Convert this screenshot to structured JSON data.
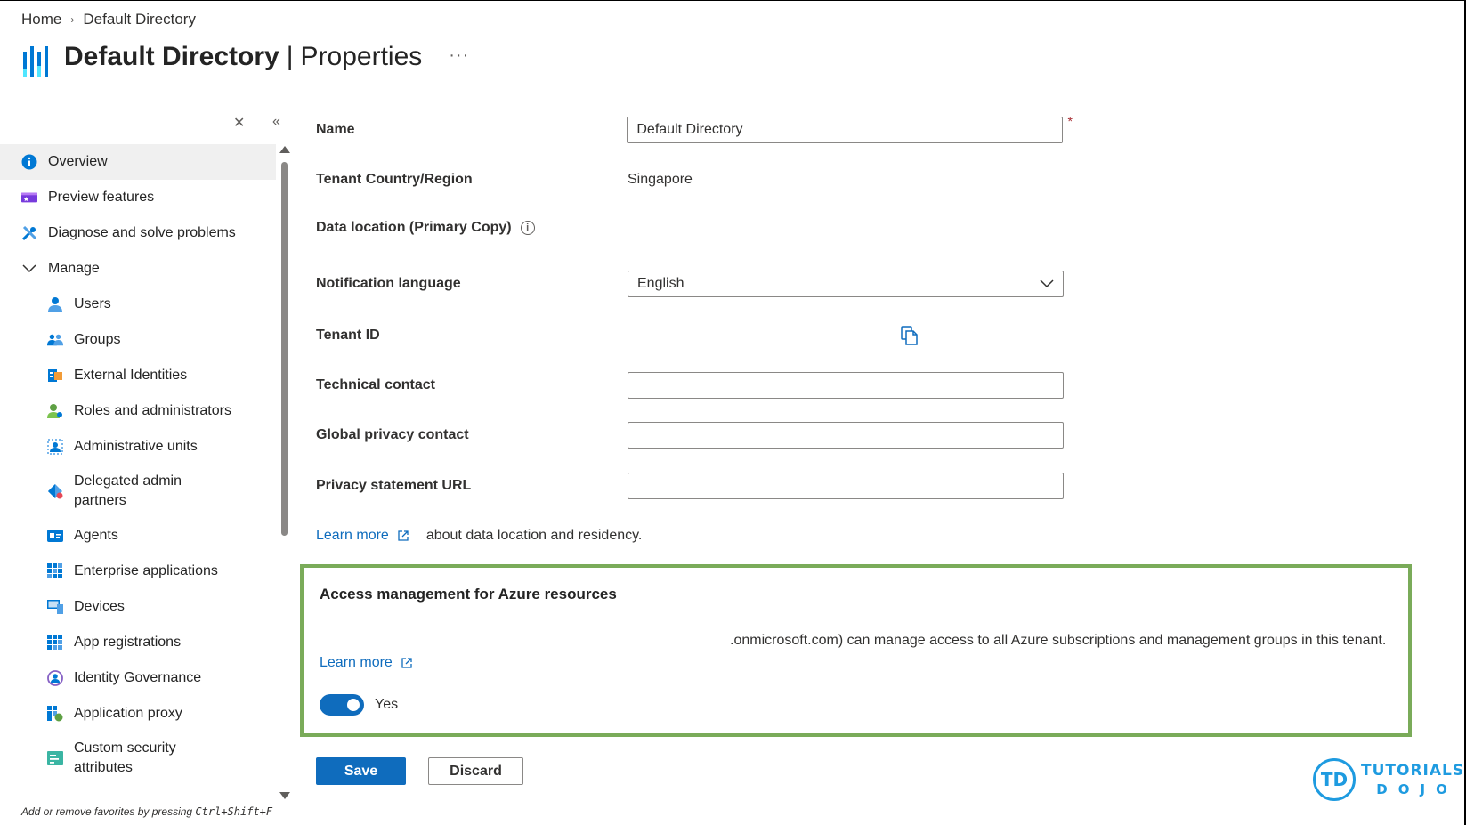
{
  "breadcrumb": {
    "home": "Home",
    "current": "Default Directory"
  },
  "header": {
    "title": "Default Directory",
    "separator": "|",
    "subtitle": "Properties",
    "more": "···"
  },
  "sidebar": {
    "close": "✕",
    "collapse": "«",
    "items": [
      {
        "label": "Overview",
        "icon": "info-icon"
      },
      {
        "label": "Preview features",
        "icon": "preview-icon"
      },
      {
        "label": "Diagnose and solve problems",
        "icon": "wrench-icon"
      },
      {
        "label": "Manage",
        "icon": "chevron-down-icon"
      },
      {
        "label": "Users",
        "icon": "user-icon"
      },
      {
        "label": "Groups",
        "icon": "groups-icon"
      },
      {
        "label": "External Identities",
        "icon": "external-identities-icon"
      },
      {
        "label": "Roles and administrators",
        "icon": "roles-icon"
      },
      {
        "label": "Administrative units",
        "icon": "admin-units-icon"
      },
      {
        "label": "Delegated admin partners",
        "icon": "delegated-icon"
      },
      {
        "label": "Agents",
        "icon": "agents-icon"
      },
      {
        "label": "Enterprise applications",
        "icon": "enterprise-apps-icon"
      },
      {
        "label": "Devices",
        "icon": "devices-icon"
      },
      {
        "label": "App registrations",
        "icon": "app-registrations-icon"
      },
      {
        "label": "Identity Governance",
        "icon": "identity-governance-icon"
      },
      {
        "label": "Application proxy",
        "icon": "app-proxy-icon"
      },
      {
        "label": "Custom security attributes",
        "icon": "custom-security-icon"
      }
    ],
    "fav_hint_prefix": "Add or remove favorites by pressing ",
    "fav_hint_keys": "Ctrl+Shift+F"
  },
  "form": {
    "name_label": "Name",
    "name_value": "Default Directory",
    "required_mark": "*",
    "country_label": "Tenant Country/Region",
    "country_value": "Singapore",
    "data_location_label": "Data location (Primary Copy)",
    "notification_label": "Notification language",
    "notification_value": "English",
    "tenant_id_label": "Tenant ID",
    "technical_contact_label": "Technical contact",
    "global_privacy_label": "Global privacy contact",
    "privacy_url_label": "Privacy statement URL",
    "learn_more": "Learn more",
    "learn_more_tail": "about data location and residency."
  },
  "access": {
    "title": "Access management for Azure resources",
    "description": ".onmicrosoft.com) can manage access to all Azure subscriptions and management groups in this tenant.",
    "learn_more": "Learn more",
    "toggle_label": "Yes",
    "toggle_on": true,
    "highlight_color": "#7aab59"
  },
  "buttons": {
    "save": "Save",
    "discard": "Discard"
  },
  "watermark": {
    "badge": "TD",
    "line1": "TUTORIALS",
    "line2": "DOJO"
  },
  "colors": {
    "accent": "#0f6cbd",
    "highlight": "#7aab59",
    "logo": "#1e9be0"
  }
}
